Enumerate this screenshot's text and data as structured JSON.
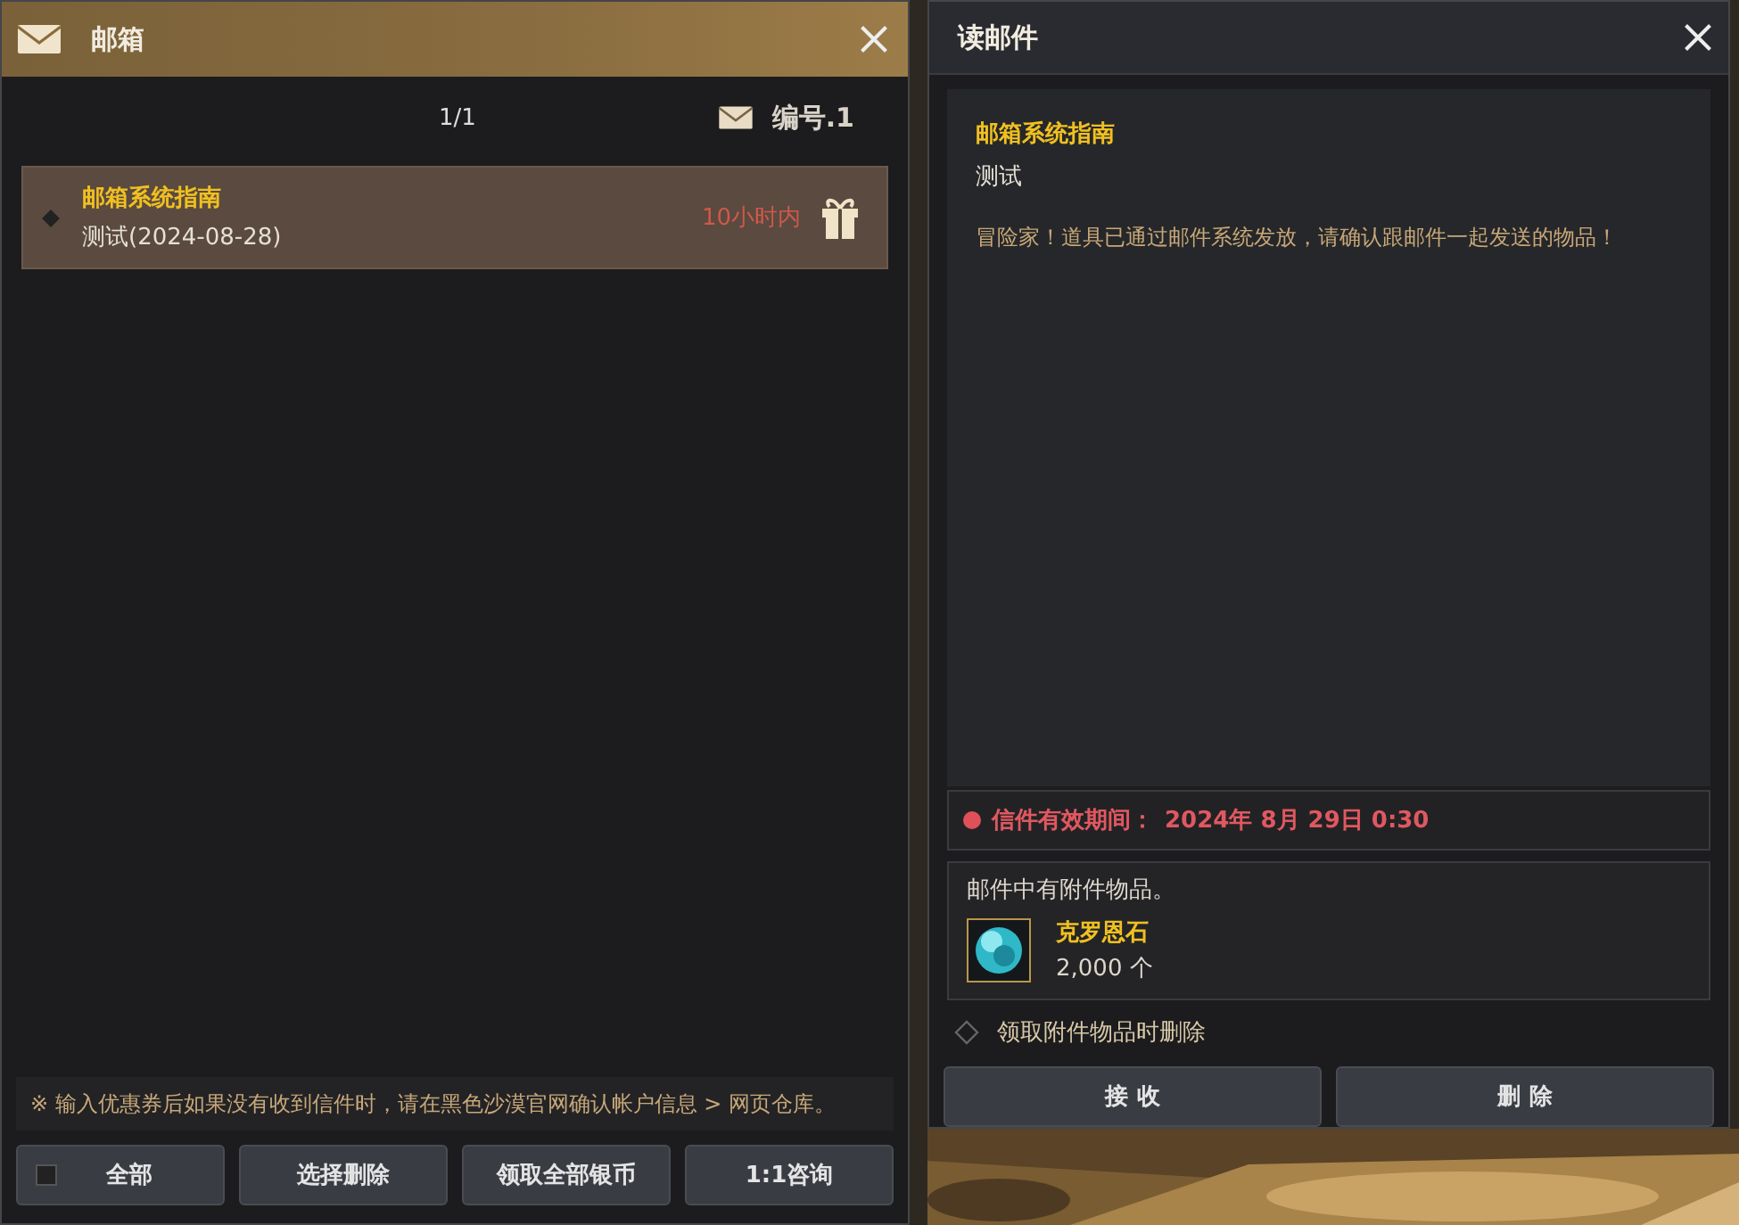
{
  "mailbox": {
    "title": "邮箱",
    "page": "1/1",
    "mail_number": "编号.1",
    "mails": [
      {
        "sender": "邮箱系统指南",
        "subject": "测试(2024-08-28)",
        "expiry": "10小时内",
        "has_gift": true,
        "selected": true
      }
    ],
    "notice": "※ 输入优惠券后如果没有收到信件时，请在黑色沙漠官网确认帐户信息 > 网页仓库。",
    "select_all": {
      "label": "全部",
      "checked": false
    },
    "buttons": [
      "选择删除",
      "领取全部银币",
      "1:1咨询"
    ]
  },
  "reader": {
    "title": "读邮件",
    "sender": "邮箱系统指南",
    "subject": "测试",
    "body": "冒险家！道具已通过邮件系统发放，请确认跟邮件一起发送的物品！",
    "expiry_label": "信件有效期间：",
    "expiry": "2024年 8月 29日 0:30",
    "attachment_heading": "邮件中有附件物品。",
    "attachments": [
      {
        "name": "克罗恩石",
        "count": "2,000 个"
      }
    ],
    "delete_on_claim": {
      "label": "领取附件物品时删除",
      "checked": false
    },
    "buttons": [
      "接 收",
      "删 除"
    ]
  }
}
